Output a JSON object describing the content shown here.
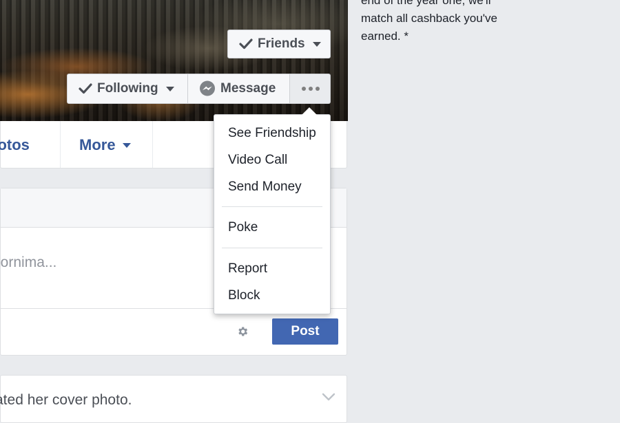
{
  "sidebar": {
    "cashback_text_top": "end of the year one, we'll",
    "cashback_text_mid": "match all cashback you've",
    "cashback_text_bottom": "earned. *"
  },
  "profile": {
    "friends_label": "Friends",
    "following_label": "Following",
    "message_label": "Message"
  },
  "nav": {
    "photos_label": "hotos",
    "more_label": "More"
  },
  "dropdown": {
    "items": [
      "See Friendship",
      "Video Call",
      "Send Money",
      "Poke",
      "Report",
      "Block"
    ]
  },
  "composer": {
    "placeholder": "oornima...",
    "post_label": "Post"
  },
  "story": {
    "text": "ated her cover photo."
  },
  "colors": {
    "accent": "#4267b2",
    "link": "#365899",
    "background": "#e9ebee"
  }
}
